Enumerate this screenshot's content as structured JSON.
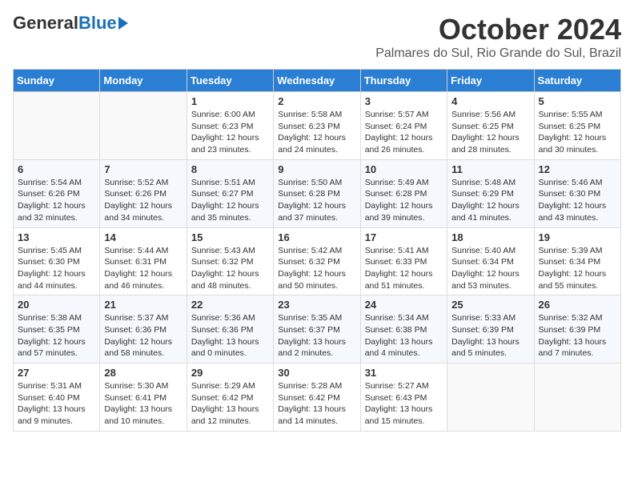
{
  "header": {
    "logo_general": "General",
    "logo_blue": "Blue",
    "month_title": "October 2024",
    "subtitle": "Palmares do Sul, Rio Grande do Sul, Brazil"
  },
  "days_of_week": [
    "Sunday",
    "Monday",
    "Tuesday",
    "Wednesday",
    "Thursday",
    "Friday",
    "Saturday"
  ],
  "weeks": [
    [
      {
        "day": "",
        "sunrise": "",
        "sunset": "",
        "daylight": ""
      },
      {
        "day": "",
        "sunrise": "",
        "sunset": "",
        "daylight": ""
      },
      {
        "day": "1",
        "sunrise": "Sunrise: 6:00 AM",
        "sunset": "Sunset: 6:23 PM",
        "daylight": "Daylight: 12 hours and 23 minutes."
      },
      {
        "day": "2",
        "sunrise": "Sunrise: 5:58 AM",
        "sunset": "Sunset: 6:23 PM",
        "daylight": "Daylight: 12 hours and 24 minutes."
      },
      {
        "day": "3",
        "sunrise": "Sunrise: 5:57 AM",
        "sunset": "Sunset: 6:24 PM",
        "daylight": "Daylight: 12 hours and 26 minutes."
      },
      {
        "day": "4",
        "sunrise": "Sunrise: 5:56 AM",
        "sunset": "Sunset: 6:25 PM",
        "daylight": "Daylight: 12 hours and 28 minutes."
      },
      {
        "day": "5",
        "sunrise": "Sunrise: 5:55 AM",
        "sunset": "Sunset: 6:25 PM",
        "daylight": "Daylight: 12 hours and 30 minutes."
      }
    ],
    [
      {
        "day": "6",
        "sunrise": "Sunrise: 5:54 AM",
        "sunset": "Sunset: 6:26 PM",
        "daylight": "Daylight: 12 hours and 32 minutes."
      },
      {
        "day": "7",
        "sunrise": "Sunrise: 5:52 AM",
        "sunset": "Sunset: 6:26 PM",
        "daylight": "Daylight: 12 hours and 34 minutes."
      },
      {
        "day": "8",
        "sunrise": "Sunrise: 5:51 AM",
        "sunset": "Sunset: 6:27 PM",
        "daylight": "Daylight: 12 hours and 35 minutes."
      },
      {
        "day": "9",
        "sunrise": "Sunrise: 5:50 AM",
        "sunset": "Sunset: 6:28 PM",
        "daylight": "Daylight: 12 hours and 37 minutes."
      },
      {
        "day": "10",
        "sunrise": "Sunrise: 5:49 AM",
        "sunset": "Sunset: 6:28 PM",
        "daylight": "Daylight: 12 hours and 39 minutes."
      },
      {
        "day": "11",
        "sunrise": "Sunrise: 5:48 AM",
        "sunset": "Sunset: 6:29 PM",
        "daylight": "Daylight: 12 hours and 41 minutes."
      },
      {
        "day": "12",
        "sunrise": "Sunrise: 5:46 AM",
        "sunset": "Sunset: 6:30 PM",
        "daylight": "Daylight: 12 hours and 43 minutes."
      }
    ],
    [
      {
        "day": "13",
        "sunrise": "Sunrise: 5:45 AM",
        "sunset": "Sunset: 6:30 PM",
        "daylight": "Daylight: 12 hours and 44 minutes."
      },
      {
        "day": "14",
        "sunrise": "Sunrise: 5:44 AM",
        "sunset": "Sunset: 6:31 PM",
        "daylight": "Daylight: 12 hours and 46 minutes."
      },
      {
        "day": "15",
        "sunrise": "Sunrise: 5:43 AM",
        "sunset": "Sunset: 6:32 PM",
        "daylight": "Daylight: 12 hours and 48 minutes."
      },
      {
        "day": "16",
        "sunrise": "Sunrise: 5:42 AM",
        "sunset": "Sunset: 6:32 PM",
        "daylight": "Daylight: 12 hours and 50 minutes."
      },
      {
        "day": "17",
        "sunrise": "Sunrise: 5:41 AM",
        "sunset": "Sunset: 6:33 PM",
        "daylight": "Daylight: 12 hours and 51 minutes."
      },
      {
        "day": "18",
        "sunrise": "Sunrise: 5:40 AM",
        "sunset": "Sunset: 6:34 PM",
        "daylight": "Daylight: 12 hours and 53 minutes."
      },
      {
        "day": "19",
        "sunrise": "Sunrise: 5:39 AM",
        "sunset": "Sunset: 6:34 PM",
        "daylight": "Daylight: 12 hours and 55 minutes."
      }
    ],
    [
      {
        "day": "20",
        "sunrise": "Sunrise: 5:38 AM",
        "sunset": "Sunset: 6:35 PM",
        "daylight": "Daylight: 12 hours and 57 minutes."
      },
      {
        "day": "21",
        "sunrise": "Sunrise: 5:37 AM",
        "sunset": "Sunset: 6:36 PM",
        "daylight": "Daylight: 12 hours and 58 minutes."
      },
      {
        "day": "22",
        "sunrise": "Sunrise: 5:36 AM",
        "sunset": "Sunset: 6:36 PM",
        "daylight": "Daylight: 13 hours and 0 minutes."
      },
      {
        "day": "23",
        "sunrise": "Sunrise: 5:35 AM",
        "sunset": "Sunset: 6:37 PM",
        "daylight": "Daylight: 13 hours and 2 minutes."
      },
      {
        "day": "24",
        "sunrise": "Sunrise: 5:34 AM",
        "sunset": "Sunset: 6:38 PM",
        "daylight": "Daylight: 13 hours and 4 minutes."
      },
      {
        "day": "25",
        "sunrise": "Sunrise: 5:33 AM",
        "sunset": "Sunset: 6:39 PM",
        "daylight": "Daylight: 13 hours and 5 minutes."
      },
      {
        "day": "26",
        "sunrise": "Sunrise: 5:32 AM",
        "sunset": "Sunset: 6:39 PM",
        "daylight": "Daylight: 13 hours and 7 minutes."
      }
    ],
    [
      {
        "day": "27",
        "sunrise": "Sunrise: 5:31 AM",
        "sunset": "Sunset: 6:40 PM",
        "daylight": "Daylight: 13 hours and 9 minutes."
      },
      {
        "day": "28",
        "sunrise": "Sunrise: 5:30 AM",
        "sunset": "Sunset: 6:41 PM",
        "daylight": "Daylight: 13 hours and 10 minutes."
      },
      {
        "day": "29",
        "sunrise": "Sunrise: 5:29 AM",
        "sunset": "Sunset: 6:42 PM",
        "daylight": "Daylight: 13 hours and 12 minutes."
      },
      {
        "day": "30",
        "sunrise": "Sunrise: 5:28 AM",
        "sunset": "Sunset: 6:42 PM",
        "daylight": "Daylight: 13 hours and 14 minutes."
      },
      {
        "day": "31",
        "sunrise": "Sunrise: 5:27 AM",
        "sunset": "Sunset: 6:43 PM",
        "daylight": "Daylight: 13 hours and 15 minutes."
      },
      {
        "day": "",
        "sunrise": "",
        "sunset": "",
        "daylight": ""
      },
      {
        "day": "",
        "sunrise": "",
        "sunset": "",
        "daylight": ""
      }
    ]
  ]
}
